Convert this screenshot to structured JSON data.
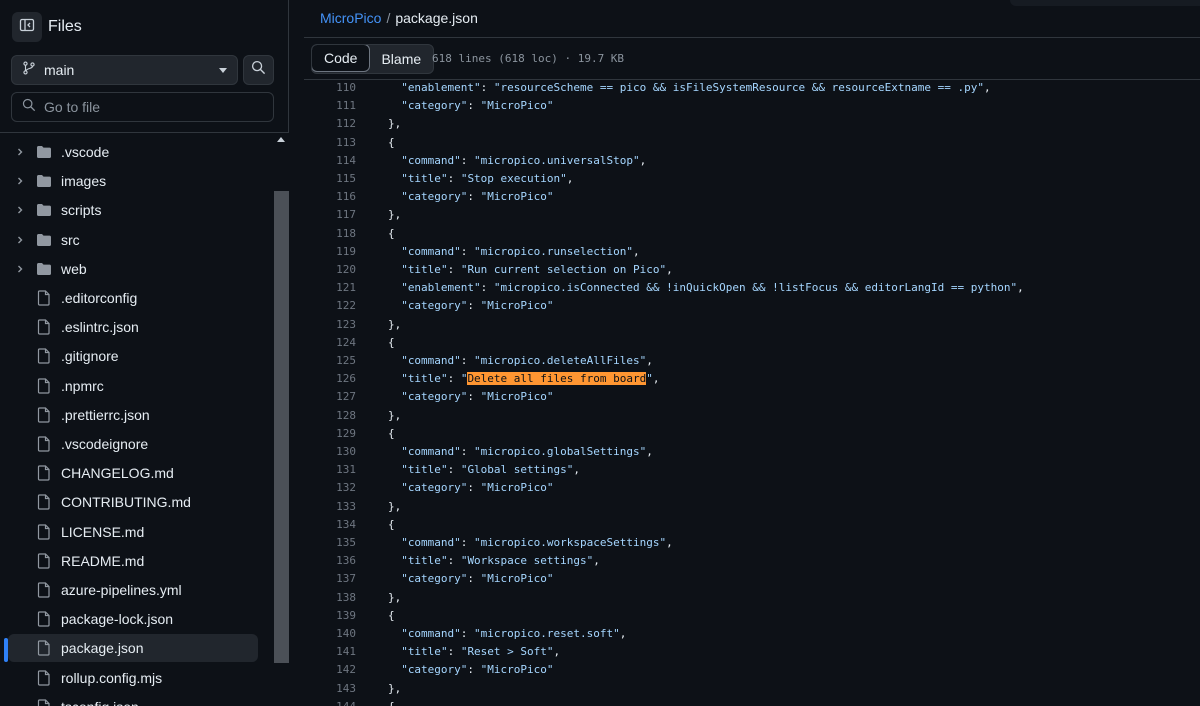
{
  "sidebar": {
    "title": "Files",
    "branch": "main",
    "goto_placeholder": "Go to file",
    "items": [
      {
        "type": "folder",
        "name": ".vscode"
      },
      {
        "type": "folder",
        "name": "images"
      },
      {
        "type": "folder",
        "name": "scripts"
      },
      {
        "type": "folder",
        "name": "src"
      },
      {
        "type": "folder",
        "name": "web"
      },
      {
        "type": "file",
        "name": ".editorconfig"
      },
      {
        "type": "file",
        "name": ".eslintrc.json"
      },
      {
        "type": "file",
        "name": ".gitignore"
      },
      {
        "type": "file",
        "name": ".npmrc"
      },
      {
        "type": "file",
        "name": ".prettierrc.json"
      },
      {
        "type": "file",
        "name": ".vscodeignore"
      },
      {
        "type": "file",
        "name": "CHANGELOG.md"
      },
      {
        "type": "file",
        "name": "CONTRIBUTING.md"
      },
      {
        "type": "file",
        "name": "LICENSE.md"
      },
      {
        "type": "file",
        "name": "README.md"
      },
      {
        "type": "file",
        "name": "azure-pipelines.yml"
      },
      {
        "type": "file",
        "name": "package-lock.json"
      },
      {
        "type": "file",
        "name": "package.json",
        "selected": true
      },
      {
        "type": "file",
        "name": "rollup.config.mjs"
      },
      {
        "type": "file",
        "name": "tsconfig.json"
      }
    ]
  },
  "breadcrumb": {
    "repo": "MicroPico",
    "separator": "/",
    "file": "package.json"
  },
  "tabs": {
    "code": "Code",
    "blame": "Blame",
    "active": "code"
  },
  "file_info": "618 lines (618 loc) · 19.7 KB",
  "code_lines": [
    {
      "n": "110",
      "indent": 10,
      "key": "enablement",
      "value": "resourceScheme == pico && isFileSystemResource && resourceExtname == .py",
      "comma": true
    },
    {
      "n": "111",
      "indent": 10,
      "key": "category",
      "value": "MicroPico",
      "comma": false
    },
    {
      "n": "112",
      "indent": 8,
      "raw": "},"
    },
    {
      "n": "113",
      "indent": 8,
      "raw": "{"
    },
    {
      "n": "114",
      "indent": 10,
      "key": "command",
      "value": "micropico.universalStop",
      "comma": true
    },
    {
      "n": "115",
      "indent": 10,
      "key": "title",
      "value": "Stop execution",
      "comma": true
    },
    {
      "n": "116",
      "indent": 10,
      "key": "category",
      "value": "MicroPico",
      "comma": false
    },
    {
      "n": "117",
      "indent": 8,
      "raw": "},"
    },
    {
      "n": "118",
      "indent": 8,
      "raw": "{"
    },
    {
      "n": "119",
      "indent": 10,
      "key": "command",
      "value": "micropico.runselection",
      "comma": true
    },
    {
      "n": "120",
      "indent": 10,
      "key": "title",
      "value": "Run current selection on Pico",
      "comma": true
    },
    {
      "n": "121",
      "indent": 10,
      "key": "enablement",
      "value": "micropico.isConnected && !inQuickOpen && !listFocus && editorLangId == python",
      "comma": true
    },
    {
      "n": "122",
      "indent": 10,
      "key": "category",
      "value": "MicroPico",
      "comma": false
    },
    {
      "n": "123",
      "indent": 8,
      "raw": "},"
    },
    {
      "n": "124",
      "indent": 8,
      "raw": "{"
    },
    {
      "n": "125",
      "indent": 10,
      "key": "command",
      "value": "micropico.deleteAllFiles",
      "comma": true
    },
    {
      "n": "126",
      "indent": 10,
      "key": "title",
      "value": "Delete all files from board",
      "comma": true,
      "highlight": true
    },
    {
      "n": "127",
      "indent": 10,
      "key": "category",
      "value": "MicroPico",
      "comma": false
    },
    {
      "n": "128",
      "indent": 8,
      "raw": "},"
    },
    {
      "n": "129",
      "indent": 8,
      "raw": "{"
    },
    {
      "n": "130",
      "indent": 10,
      "key": "command",
      "value": "micropico.globalSettings",
      "comma": true
    },
    {
      "n": "131",
      "indent": 10,
      "key": "title",
      "value": "Global settings",
      "comma": true
    },
    {
      "n": "132",
      "indent": 10,
      "key": "category",
      "value": "MicroPico",
      "comma": false
    },
    {
      "n": "133",
      "indent": 8,
      "raw": "},"
    },
    {
      "n": "134",
      "indent": 8,
      "raw": "{"
    },
    {
      "n": "135",
      "indent": 10,
      "key": "command",
      "value": "micropico.workspaceSettings",
      "comma": true
    },
    {
      "n": "136",
      "indent": 10,
      "key": "title",
      "value": "Workspace settings",
      "comma": true
    },
    {
      "n": "137",
      "indent": 10,
      "key": "category",
      "value": "MicroPico",
      "comma": false
    },
    {
      "n": "138",
      "indent": 8,
      "raw": "},"
    },
    {
      "n": "139",
      "indent": 8,
      "raw": "{"
    },
    {
      "n": "140",
      "indent": 10,
      "key": "command",
      "value": "micropico.reset.soft",
      "comma": true
    },
    {
      "n": "141",
      "indent": 10,
      "key": "title",
      "value": "Reset > Soft",
      "comma": true
    },
    {
      "n": "142",
      "indent": 10,
      "key": "category",
      "value": "MicroPico",
      "comma": false
    },
    {
      "n": "143",
      "indent": 8,
      "raw": "},"
    },
    {
      "n": "144",
      "indent": 8,
      "raw": "{"
    }
  ],
  "colors": {
    "background": "#0d1117",
    "border": "#30363d",
    "link": "#4493f8",
    "string": "#a5d6ff",
    "search_highlight": "#ff9632",
    "selected_indicator": "#2f81f7"
  },
  "icons": {
    "panel_toggle": "sidebar-collapse-icon",
    "branch": "git-branch-icon",
    "search": "search-icon",
    "folder": "folder-icon",
    "file": "file-icon",
    "chevron": "chevron-right-icon"
  }
}
